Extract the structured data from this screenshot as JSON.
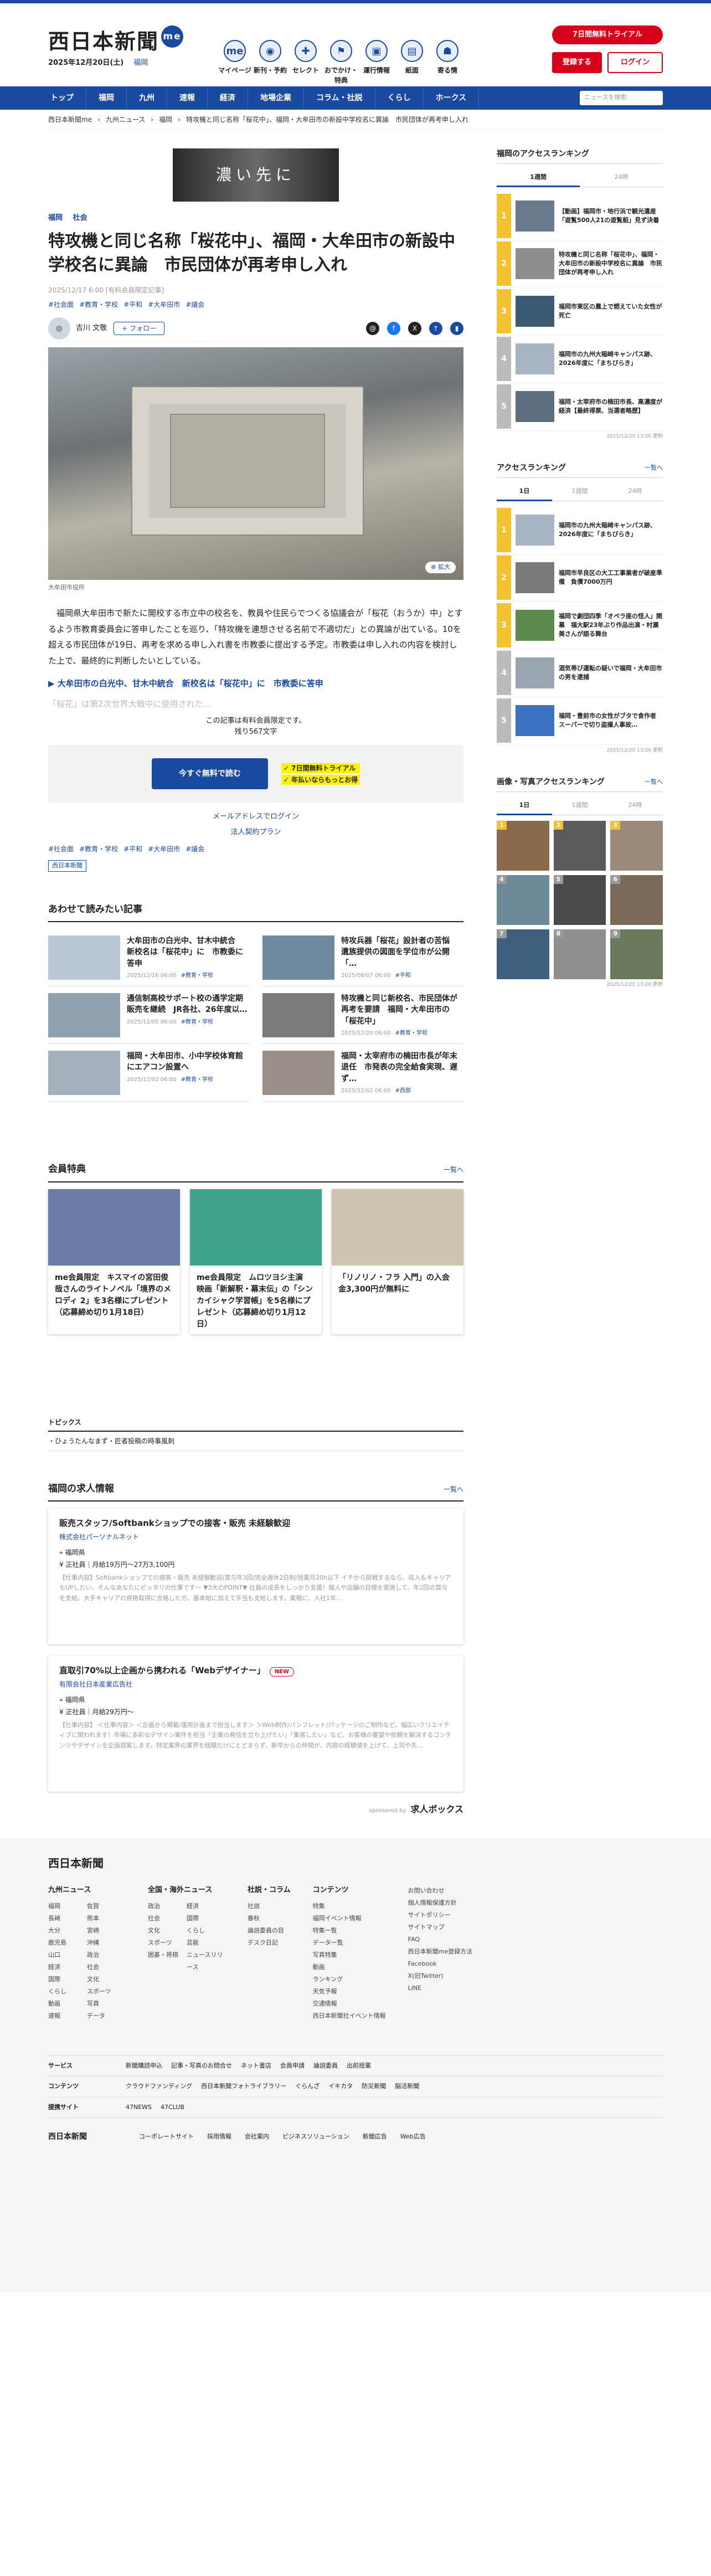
{
  "header": {
    "logo": "西日本新聞",
    "logo_me": "me",
    "date": "2025年12月20日(土)",
    "area": "福岡",
    "nav": [
      {
        "label": "マイページ",
        "icon": "me-icon",
        "glyph": "me"
      },
      {
        "label": "新刊・予約",
        "icon": "newspaper-icon",
        "glyph": "◉"
      },
      {
        "label": "セレクト",
        "icon": "select-icon",
        "glyph": "✚"
      },
      {
        "label": "おでかけ・特典",
        "icon": "outing-icon",
        "glyph": "⚑"
      },
      {
        "label": "運行情報",
        "icon": "train-icon",
        "glyph": "▣"
      },
      {
        "label": "紙面",
        "icon": "paper-icon",
        "glyph": "▤"
      },
      {
        "label": "寄る情",
        "icon": "info-icon",
        "glyph": "☗"
      }
    ],
    "trial_button": "7日間無料トライアル",
    "register_button": "登録する",
    "login_button": "ログイン"
  },
  "gnav": {
    "items": [
      "トップ",
      "福岡",
      "九州",
      "速報",
      "経済",
      "地場企業",
      "コラム・社説",
      "くらし",
      "ホークス"
    ],
    "search_placeholder": "ニュースを検索"
  },
  "breadcrumb": [
    "西日本新聞me",
    "九州ニュース",
    "福岡",
    "特攻機と同じ名称「桜花中」、福岡・大牟田市の新設中学校名に異論　市民団体が再考申し入れ"
  ],
  "ad_text": "濃い先に",
  "article": {
    "categories": [
      "福岡",
      "社会"
    ],
    "title": "特攻機と同じ名称「桜花中」、福岡・大牟田市の新設中学校名に異論　市民団体が再考申し入れ",
    "pubdate": "2025/12/17 6:00 [有料会員限定記事]",
    "tags": [
      "#社会面",
      "#教育・学校",
      "#平和",
      "#大牟田市",
      "#議会"
    ],
    "author": "吉川 文敬",
    "follow": "+ フォロー",
    "zoom": "拡大",
    "caption": "大牟田市役所",
    "paragraph": "福岡県大牟田市で新たに開校する市立中の校名を、教員や住民らでつくる協議会が「桜花（おうか）中」とするよう市教育委員会に答申したことを巡り、「特攻機を連想させる名前で不適切だ」との異論が出ている。10を超える市民団体が19日、再考を求める申し入れ書を市教委に提出する予定。市教委は申し入れの内容を検討した上で、最終的に判断したいとしている。",
    "related_link": "大牟田市の白光中、甘木中統合　新校名は「桜花中」に　市教委に答申",
    "faded_text": "「桜花」は第2次世界大戦中に使用された…",
    "paywall_note": "この記事は有料会員限定です。",
    "remaining": "残り567文字",
    "pay_button": "今すぐ無料で読む",
    "pay_points": [
      "7日間無料トライアル",
      "年払いならもっとお得"
    ],
    "mail_login": "メールアドレスでログイン",
    "corporate": "法人契約プラン",
    "bottom_tags": [
      "#社会面",
      "#教育・学校",
      "#平和",
      "#大牟田市",
      "#議会"
    ],
    "source": "西日本新聞"
  },
  "related": {
    "heading": "あわせて読みたい記事",
    "items": [
      {
        "title": "大牟田市の白光中、甘木中統合　新校名は「桜花中」に　市教委に答申",
        "date": "2025/12/16 06:00",
        "cat": "#教育・学校"
      },
      {
        "title": "特攻兵器「桜花」設計者の苦悩　遺族提供の図面を学位市が公開「…",
        "date": "2025/08/07 06:00",
        "cat": "#平和"
      },
      {
        "title": "通信制高校サポート校の通学定期販売を継続　JR各社、26年度以…",
        "date": "2025/12/05 06:00",
        "cat": "#教育・学校"
      },
      {
        "title": "特攻機と同じ新校名、市民団体が再考を要請　福岡・大牟田市の「桜花中」",
        "date": "2025/12/20 06:00",
        "cat": "#教育・学校"
      },
      {
        "title": "福岡・大牟田市、小中学校体育館にエアコン設置へ",
        "date": "2025/12/02 06:00",
        "cat": "#教育・学校"
      },
      {
        "title": "福岡・太宰府市の楠田市長が年末退任　市発表の完全給食実現、遅ず…",
        "date": "2025/12/02 06:00",
        "cat": "#西部"
      }
    ]
  },
  "members": {
    "heading": "会員特典",
    "more": "一覧へ",
    "cards": [
      {
        "title": "me会員限定　キスマイの宮田俊哉さんのライトノベル「境界のメロディ 2」を3名様にプレゼント（応募締め切り1月18日）"
      },
      {
        "title": "me会員限定　ムロツヨシ主演　映画「新解釈・幕末伝」の「シンカイシャク学習帳」を5名様にプレゼント（応募締め切り1月12日）"
      },
      {
        "title": "「リノリノ・フラ 入門」の入会金3,300円が無料に"
      }
    ]
  },
  "topics": {
    "heading": "トピックス",
    "item": "・ひょうたんなまず・匠者投稿の時事風刺"
  },
  "jobs": {
    "heading": "福岡の求人情報",
    "more": "一覧へ",
    "items": [
      {
        "title": "販売スタッフ/Softbankショップでの接客・販売 未経験歓迎",
        "company": "株式会社パーソナルネット",
        "place": "福岡県",
        "pay": "正社員｜月給19万円〜27万3,100円",
        "desc": "【仕事内容】Softbankショップでの接客・販売 未経験歓迎(賞与年3回/完全週休2日制/残業月20h以下 イチから挑戦するなら、収入もキャリアもUPしたい、そんなあなたにピッタリの仕事です〜 ▼3大のPOINT▼ 社員の成長をしっかり支援！個人や店舗の目標を実施して、年2回の賞与を支給。大手キャリアの資格取得に合格した方、基本給に加えて手当も支給します。業務に、入社1年…",
        "new": ""
      },
      {
        "title": "直取引70%以上企画から携われる「Webデザイナー」",
        "company": "有限会社日本産業広告社",
        "place": "福岡県",
        "pay": "正社員｜月給29万円〜",
        "desc": "【仕事内容】 ＜仕事内容＞ ＜企画から掲載/運用計画まで担当します＞ ＞Web制作/パンフレット/パッケージのご制作など、幅広いクリエイティブに関われます！市場に多彩なデザイン案件を担当「企業の発信を立ち上げたい」「集客したい」など、お客様の要望や依頼を解決するコンテンツやデザインを企画提案します。特定業界の業界を経験だけにとどまらず、新卒からの仲間が、内容の経験値を上げて、上司や先…",
        "new": "NEW"
      }
    ],
    "sponsor_label": "sponsored by",
    "sponsor_name": "求人ボックス"
  },
  "sidebar": {
    "rank1": {
      "heading": "福岡のアクセスランキング",
      "tabs": [
        "1週間",
        "24時"
      ],
      "items": [
        "【動画】福岡市・地行浜で観光遺産「遊覧500人21の遊覧船」見ず決着",
        "特攻機と同じ名称「桜花中」、福岡・大牟田市の新設中学校名に異論　市民団体が再考申し入れ",
        "福岡市東区の農上で燃えていた女性が死亡",
        "福岡市の九州大稲崎キャンパス跡、2026年度に「まちびらき」",
        "福岡・太宰府市の楠田市長、高濃度が経済【最終得票、当選者略歴】"
      ],
      "timestamp": "2025/12/20 13:00 更新"
    },
    "rank2": {
      "heading": "アクセスランキング",
      "more": "一覧へ",
      "tabs": [
        "1日",
        "1週間",
        "24時"
      ],
      "items": [
        "福岡市の九州大稲崎キャンパス跡、2026年度に「まちびらき」",
        "福岡市早良区の大工工事業者が破産準備　負債7000万円",
        "福岡で劇団四季「オペラ座の怪人」開幕　福大駅23年ぶり作品出演・村瀬美さんが語る舞台",
        "酒気帯び運転の疑いで福岡・大牟田市の男を逮捕",
        "福岡・豊前市の女性がブタで食作者　スーパーで切り盗撮人事故…"
      ],
      "timestamp": "2025/12/20 13:00 更新"
    },
    "photos": {
      "heading": "画像・写真アクセスランキング",
      "more": "一覧へ",
      "tabs": [
        "1日",
        "1週間",
        "24時"
      ],
      "count": 9,
      "timestamp": "2025/12/20 13:00 更新"
    }
  },
  "footer": {
    "logo": "西日本新聞",
    "cols": [
      {
        "heading": "九州ニュース",
        "items": [
          "福岡",
          "佐賀",
          "長崎",
          "熊本",
          "大分",
          "宮崎",
          "鹿児島",
          "沖縄",
          "山口",
          "政治",
          "経済",
          "社会",
          "国際",
          "文化",
          "くらし",
          "スポーツ",
          "動画",
          "写真",
          "速報",
          "データ"
        ]
      },
      {
        "heading": "全国・海外ニュース",
        "items": [
          "政治",
          "経済",
          "社会",
          "国際",
          "文化",
          "くらし",
          "スポーツ",
          "芸能",
          "囲碁・将棋",
          "ニュースリリース"
        ]
      },
      {
        "heading": "社説・コラム",
        "items": [
          "社説",
          "春秋",
          "論説委員の目",
          "デスク日記"
        ]
      },
      {
        "heading": "コンテンツ",
        "items": [
          "特集",
          "福岡イベント情報",
          "特集一覧",
          "データ一覧",
          "写真特集",
          "動画",
          "ランキング",
          "天気予報",
          "交通情報",
          "西日本新聞社イベント情報"
        ]
      },
      {
        "heading": "",
        "items": [
          "お問い合わせ",
          "個人情報保護方針",
          "サイトポリシー",
          "サイトマップ",
          "FAQ",
          "西日本新聞me登録方法",
          "Facebook",
          "X(旧Twitter)",
          "LINE"
        ]
      }
    ],
    "rows": [
      {
        "label": "サービス",
        "links": [
          "新聞購読申込",
          "記事・写真のお問合せ",
          "ネット書店",
          "会員申請",
          "論説委員",
          "出前授業"
        ]
      },
      {
        "label": "コンテンツ",
        "links": [
          "クラウドファンディング",
          "西日本新聞フォトライブラリー",
          "ぐらんざ",
          "イキカタ",
          "防災新聞",
          "脳活新聞"
        ]
      },
      {
        "label": "提携サイト",
        "links": [
          "47NEWS",
          "47CLUB"
        ]
      }
    ],
    "bottom": [
      "コーポレートサイト",
      "採用情報",
      "会社案内",
      "ビジネスソリューション",
      "新聞広告",
      "Web広告"
    ]
  }
}
